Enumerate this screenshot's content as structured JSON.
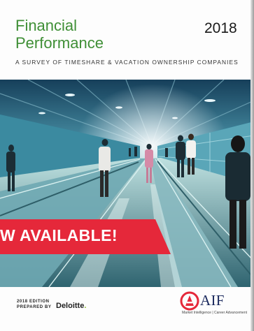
{
  "cover": {
    "title_line1": "Financial",
    "title_line2": "Performance",
    "year": "2018",
    "subtitle": "A SURVEY OF TIMESHARE & VACATION OWNERSHIP COMPANIES"
  },
  "banner": {
    "text": "W AVAILABLE!",
    "color": "#e5283a"
  },
  "footer": {
    "edition_line1": "2018 EDITION",
    "edition_line2": "PREPARED BY",
    "deloitte_name": "Deloitte",
    "deloitte_dot": ".",
    "aif_name": "AIF",
    "aif_tagline": "Market Intelligence | Career Advancement"
  },
  "colors": {
    "title_green": "#3f8f36",
    "aif_red": "#e5283a",
    "aif_navy": "#1b2a5e"
  }
}
